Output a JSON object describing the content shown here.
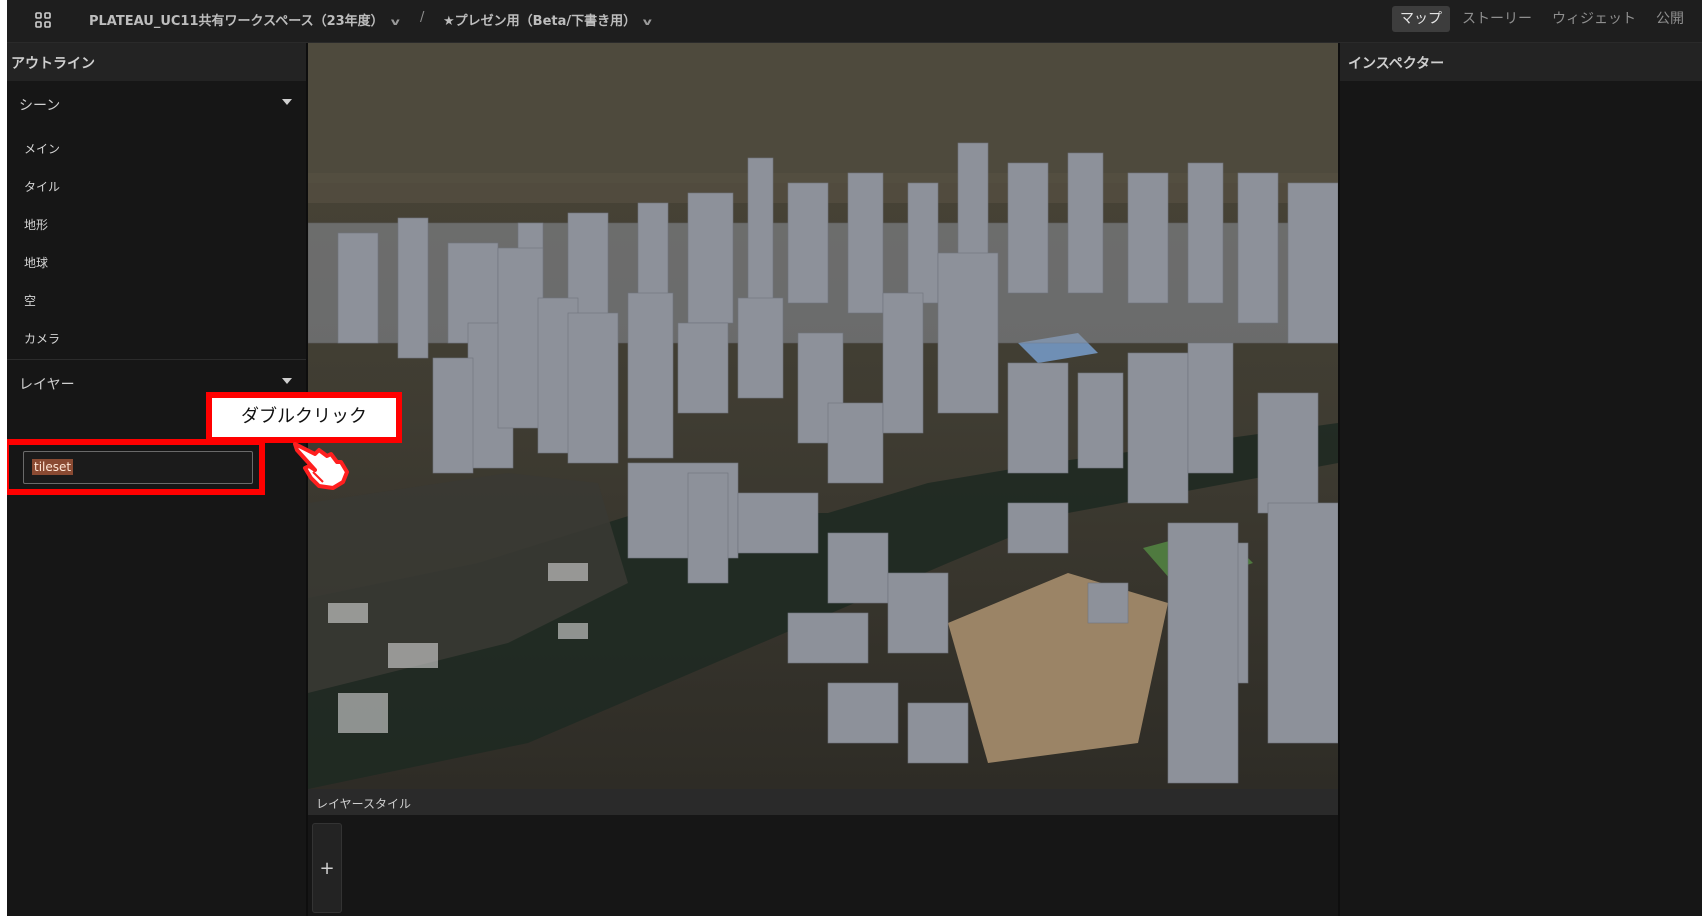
{
  "header": {
    "workspace": "PLATEAU_UC11共有ワークスペース（23年度）",
    "separator": "/",
    "project": "★プレゼン用（Beta/下書き用）",
    "tabs": [
      {
        "label": "マップ",
        "active": true
      },
      {
        "label": "ストーリー",
        "active": false
      },
      {
        "label": "ウィジェット",
        "active": false
      },
      {
        "label": "公開",
        "active": false
      }
    ]
  },
  "outline": {
    "title": "アウトライン",
    "scene": {
      "label": "シーン",
      "items": [
        "メイン",
        "タイル",
        "地形",
        "地球",
        "空",
        "カメラ"
      ]
    },
    "layers": {
      "label": "レイヤー",
      "items": [
        {
          "name": "tileset"
        }
      ]
    }
  },
  "annotation": {
    "callout": "ダブルクリック",
    "highlight_color": "#ff0000"
  },
  "bottom_panel": {
    "title": "レイヤースタイル",
    "add_label": "+"
  },
  "inspector": {
    "title": "インスペクター"
  },
  "colors": {
    "background": "#161616",
    "building": "#8e929c",
    "active_tab": "#3d3d3d"
  }
}
